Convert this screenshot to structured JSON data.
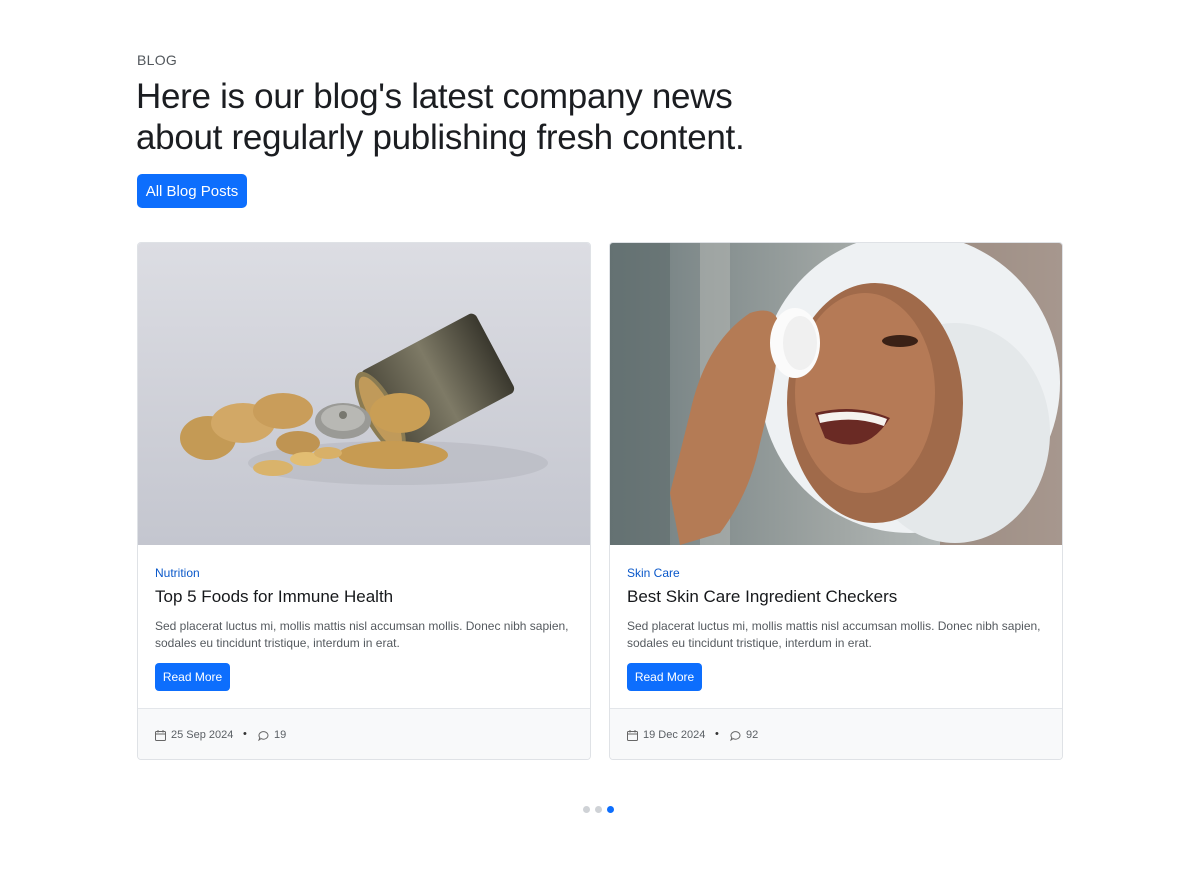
{
  "header": {
    "eyebrow": "BLOG",
    "headline": "Here is our blog's latest company news about regularly publishing fresh content.",
    "button_label": "All Blog Posts"
  },
  "posts": [
    {
      "category": "Nutrition",
      "title": "Top 5 Foods for Immune Health",
      "excerpt": "Sed placerat luctus mi, mollis mattis nisl accumsan mollis. Donec nibh sapien, sodales eu tincidunt tristique, interdum in erat.",
      "read_more": "Read More",
      "date": "25 Sep 2024",
      "separator": "•",
      "comments": "19",
      "image": "ginger-and-spice-tin-photo"
    },
    {
      "category": "Skin Care",
      "title": "Best Skin Care Ingredient Checkers",
      "excerpt": "Sed placerat luctus mi, mollis mattis nisl accumsan mollis. Donec nibh sapien, sodales eu tincidunt tristique, interdum in erat.",
      "read_more": "Read More",
      "date": "19 Dec 2024",
      "separator": "•",
      "comments": "92",
      "image": "woman-with-cotton-pad-photo"
    }
  ],
  "pagination": {
    "total": 3,
    "active_index": 2
  },
  "colors": {
    "accent": "#0d6efd",
    "category_link": "#0a58ca",
    "footer_bg": "#f8f9fa"
  },
  "icons": {
    "date": "calendar-icon",
    "comments": "comment-icon"
  }
}
